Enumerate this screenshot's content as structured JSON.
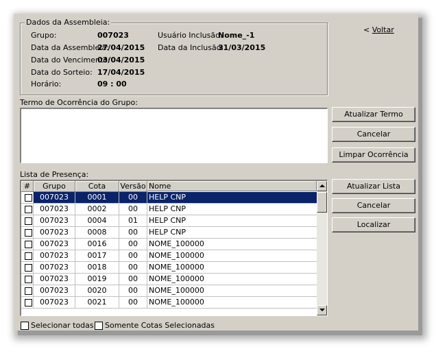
{
  "assembly": {
    "title": "Dados da Assembleia:",
    "grupo_label": "Grupo:",
    "grupo_value": "007023",
    "data_assembleia_label": "Data da Assembleia:",
    "data_assembleia_value": "27/04/2015",
    "data_vencimento_label": "Data do Vencimento:",
    "data_vencimento_value": "03/04/2015",
    "data_sorteio_label": "Data do Sorteio:",
    "data_sorteio_value": "17/04/2015",
    "horario_label": "Horário:",
    "horario_value": "09 : 00",
    "usuario_label": "Usuário Inclusão:",
    "usuario_value": "Nome_-1",
    "data_inclusao_label": "Data da Inclusão:",
    "data_inclusao_value": "31/03/2015"
  },
  "voltar": {
    "prefix": "< ",
    "label": "Voltar"
  },
  "termo": {
    "label": "Termo de Ocorrência do Grupo:",
    "value": ""
  },
  "termo_buttons": {
    "atualizar": "Atualizar Termo",
    "cancelar": "Cancelar",
    "limpar": "Limpar Ocorrência"
  },
  "lista": {
    "label": "Lista de Presença:",
    "columns": [
      "#",
      "Grupo",
      "Cota",
      "Versão",
      "Nome"
    ],
    "rows": [
      {
        "grupo": "007023",
        "cota": "0001",
        "versao": "00",
        "nome": "HELP CNP"
      },
      {
        "grupo": "007023",
        "cota": "0002",
        "versao": "00",
        "nome": "HELP CNP"
      },
      {
        "grupo": "007023",
        "cota": "0004",
        "versao": "01",
        "nome": "HELP CNP"
      },
      {
        "grupo": "007023",
        "cota": "0008",
        "versao": "00",
        "nome": "HELP CNP"
      },
      {
        "grupo": "007023",
        "cota": "0016",
        "versao": "00",
        "nome": "NOME_100000"
      },
      {
        "grupo": "007023",
        "cota": "0017",
        "versao": "00",
        "nome": "NOME_100000"
      },
      {
        "grupo": "007023",
        "cota": "0018",
        "versao": "00",
        "nome": "NOME_100000"
      },
      {
        "grupo": "007023",
        "cota": "0019",
        "versao": "00",
        "nome": "NOME_100000"
      },
      {
        "grupo": "007023",
        "cota": "0020",
        "versao": "00",
        "nome": "NOME_100000"
      },
      {
        "grupo": "007023",
        "cota": "0021",
        "versao": "00",
        "nome": "NOME_100000"
      }
    ]
  },
  "lista_buttons": {
    "atualizar": "Atualizar Lista",
    "cancelar": "Cancelar",
    "localizar": "Localizar"
  },
  "footer": {
    "selecionar_todas": "Selecionar todas",
    "somente_selecionadas": "Somente Cotas Selecionadas"
  },
  "colors": {
    "selection": "#0a246a",
    "window": "#d4d0c8"
  }
}
